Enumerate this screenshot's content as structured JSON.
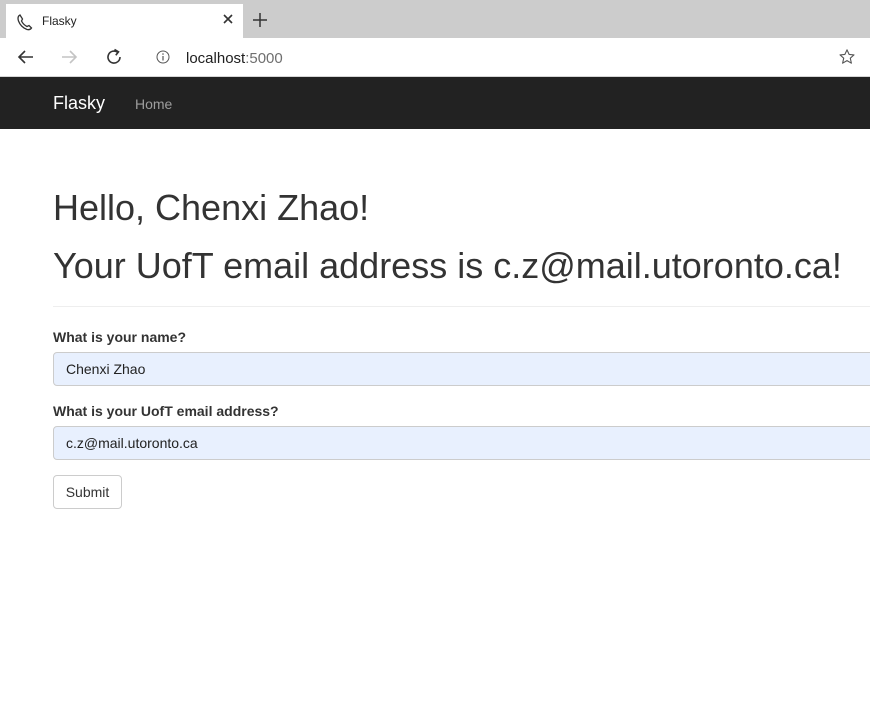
{
  "browser": {
    "tab": {
      "title": "Flasky",
      "favicon": "phone-favicon-icon"
    },
    "new_tab_icon": "plus-icon",
    "nav": {
      "back_icon": "back-arrow-icon",
      "forward_icon": "forward-arrow-icon",
      "reload_icon": "reload-icon"
    },
    "address": {
      "host": "localhost",
      "port": ":5000",
      "info_icon": "info-icon",
      "bookmark_icon": "star-icon"
    }
  },
  "navbar": {
    "brand": "Flasky",
    "links": [
      {
        "label": "Home"
      }
    ]
  },
  "page": {
    "greeting": "Hello, Chenxi Zhao!",
    "email_line": "Your UofT email address is c.z@mail.utoronto.ca!",
    "form": {
      "name_label": "What is your name?",
      "name_value": "Chenxi Zhao",
      "email_label": "What is your UofT email address?",
      "email_value": "c.z@mail.utoronto.ca",
      "submit_label": "Submit"
    }
  },
  "colors": {
    "navbar_bg": "#222222",
    "navbar_brand": "#ffffff",
    "navbar_link": "#9d9d9d",
    "autofill_bg": "#e8f0fe",
    "tabstrip_bg": "#cccccc"
  }
}
